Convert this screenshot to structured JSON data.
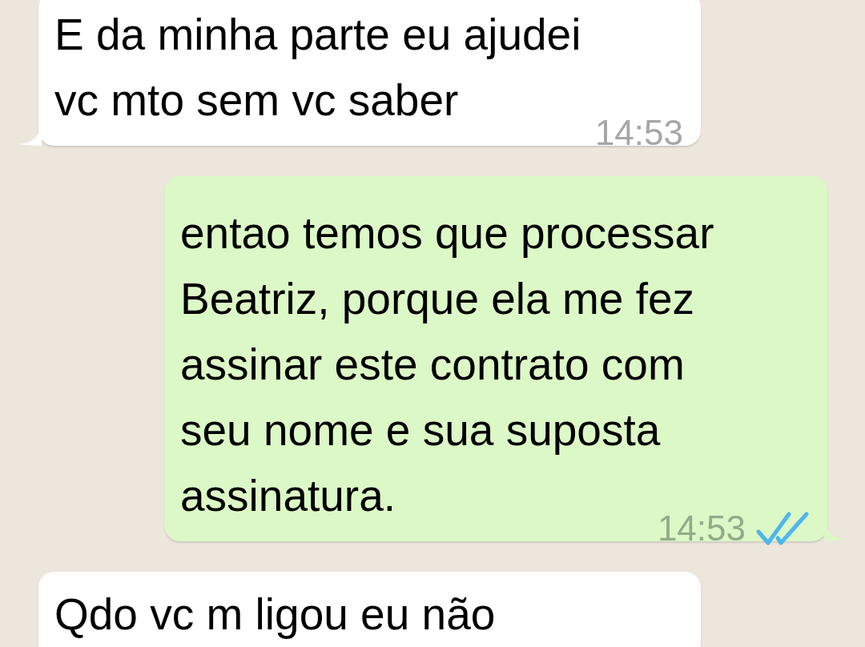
{
  "messages": [
    {
      "kind": "incoming",
      "lines": [
        "E da minha parte eu ajudei",
        "vc mto sem vc saber"
      ],
      "time": "14:53"
    },
    {
      "kind": "outgoing",
      "lines": [
        "entao temos que processar",
        "Beatriz, porque ela me fez",
        "assinar este contrato com",
        "seu nome e sua suposta",
        "assinatura."
      ],
      "time": "14:53",
      "read": true
    },
    {
      "kind": "incoming",
      "lines": [
        "Qdo vc m ligou eu não"
      ]
    }
  ]
}
